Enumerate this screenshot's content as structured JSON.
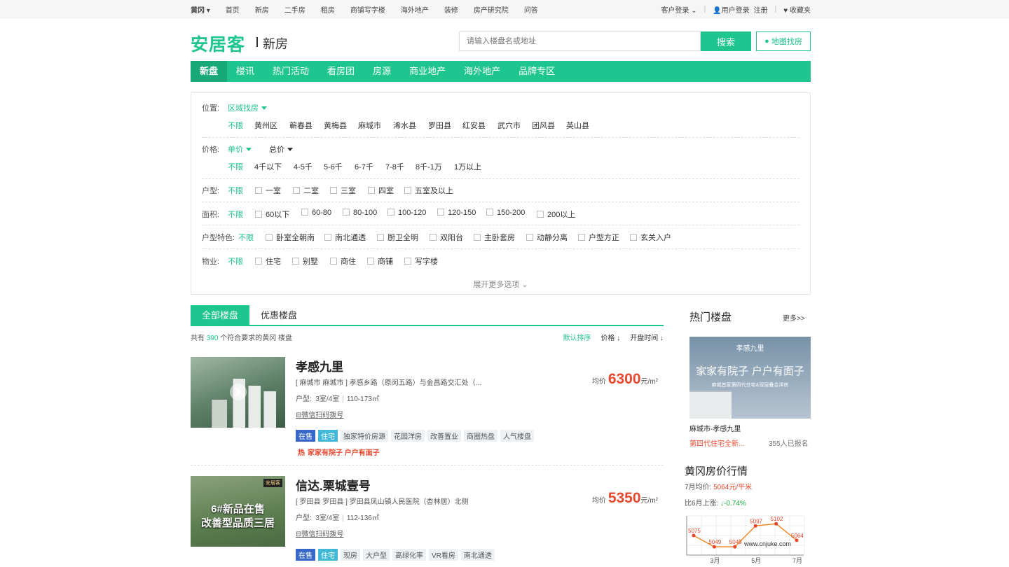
{
  "topbar": {
    "city": "黄冈",
    "nav": [
      "首页",
      "新房",
      "二手房",
      "租房",
      "商铺写字楼",
      "海外地产",
      "装修",
      "房产研究院",
      "问答"
    ],
    "client_login": "客户登录",
    "user_login": "用户登录",
    "register": "注册",
    "favorites": "收藏夹"
  },
  "header": {
    "logo": "安居客",
    "sub": "新房",
    "search_placeholder": "请输入楼盘名或地址",
    "search_button": "搜索",
    "map_button": "地图找房"
  },
  "mainnav": [
    "新盘",
    "楼讯",
    "热门活动",
    "看房团",
    "房源",
    "商业地产",
    "海外地产",
    "品牌专区"
  ],
  "filter": {
    "location": {
      "label": "位置:",
      "mode": "区域找房",
      "unlimited": "不限",
      "options": [
        "黄州区",
        "蕲春县",
        "黄梅县",
        "麻城市",
        "浠水县",
        "罗田县",
        "红安县",
        "武穴市",
        "团风县",
        "英山县"
      ]
    },
    "price": {
      "label": "价格:",
      "mode1": "单价",
      "mode2": "总价",
      "unlimited": "不限",
      "options": [
        "4千以下",
        "4-5千",
        "5-6千",
        "6-7千",
        "7-8千",
        "8千-1万",
        "1万以上"
      ]
    },
    "rooms": {
      "label": "户型:",
      "unlimited": "不限",
      "options": [
        "一室",
        "二室",
        "三室",
        "四室",
        "五室及以上"
      ]
    },
    "area": {
      "label": "面积:",
      "unlimited": "不限",
      "options": [
        "60以下",
        "60-80",
        "80-100",
        "100-120",
        "120-150",
        "150-200",
        "200以上"
      ]
    },
    "features": {
      "label": "户型特色:",
      "unlimited": "不限",
      "options": [
        "卧室全朝南",
        "南北通透",
        "厨卫全明",
        "双阳台",
        "主卧套房",
        "动静分离",
        "户型方正",
        "玄关入户"
      ]
    },
    "property": {
      "label": "物业:",
      "unlimited": "不限",
      "options": [
        "住宅",
        "别墅",
        "商住",
        "商铺",
        "写字楼"
      ]
    },
    "more": "展开更多选项"
  },
  "tabs": {
    "all": "全部楼盘",
    "discount": "优惠楼盘"
  },
  "count": {
    "prefix": "共有",
    "number": "390",
    "suffix": "个符合要求的黄冈 楼盘"
  },
  "sorts": [
    "默认排序",
    "价格",
    "开盘时间"
  ],
  "listings": [
    {
      "title": "孝感九里",
      "address": "[ 麻城市 麻城市 ] 孝感乡路（原闵五路）与金昌路交汇处（...",
      "layout_label": "户型:",
      "layout": "3室/4室",
      "area": "110-173㎡",
      "scan": "微信扫码拨号",
      "price_prefix": "均价",
      "price": "6300",
      "price_unit": "元/m²",
      "tags": [
        "在售",
        "住宅",
        "独家特价房源",
        "花园洋房",
        "改善置业",
        "商圈热盘",
        "人气楼盘"
      ],
      "hot_mark": "热",
      "hot": "家家有院子 户户有面子"
    },
    {
      "title": "信达.栗城壹号",
      "address": "[ 罗田县 罗田县 ] 罗田县凤山镇人民医院（杏林居）北侧",
      "layout_label": "户型:",
      "layout": "3室/4室",
      "area": "112-136㎡",
      "scan": "微信扫码拨号",
      "price_prefix": "均价",
      "price": "5350",
      "price_unit": "元/m²",
      "tags": [
        "在售",
        "住宅",
        "现房",
        "大户型",
        "高绿化率",
        "VR看房",
        "南北通透"
      ],
      "thumb_text1": "6#新品在售",
      "thumb_text2": "改善型品质三居",
      "thumb_badge": "安居客"
    }
  ],
  "sidebar": {
    "hot_title": "热门楼盘",
    "more": "更多>>",
    "ad_brand": "孝感九里",
    "ad_headline": "家家有院子 户户有面子",
    "ad_sub": "麻城首家第四代住宅&双层叠合洋房",
    "ad_name": "麻城市-孝感九里",
    "ad_slogan": "第四代住宅全新...",
    "ad_signed": "355人已报名",
    "market_title": "黄冈房价行情",
    "avg_label": "7月均价:",
    "avg_value": "5064元/平米",
    "chg_label": "比6月上涨:",
    "chg_value": "↓-0.74%",
    "watermark": "www.cnjuke.com"
  },
  "chart_data": {
    "type": "line",
    "categories": [
      "3月",
      "5月",
      "7月"
    ],
    "points": [
      5075,
      5049,
      5049,
      5097,
      5102,
      5064
    ],
    "point_labels": [
      "5075",
      "5049",
      "5049",
      "5097",
      "5102",
      "5064"
    ],
    "ylim": [
      5030,
      5120
    ]
  }
}
